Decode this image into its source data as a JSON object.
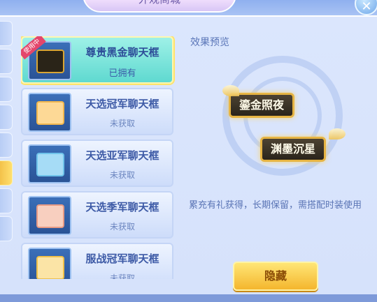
{
  "header": {
    "title": "外观商城"
  },
  "list": {
    "items": [
      {
        "name": "尊贵黑金聊天框",
        "status": "已拥有",
        "badge": "使用中",
        "frame": "black"
      },
      {
        "name": "天选冠军聊天框",
        "status": "未获取",
        "frame": "champion"
      },
      {
        "name": "天选亚军聊天框",
        "status": "未获取",
        "frame": "silver"
      },
      {
        "name": "天选季军聊天框",
        "status": "未获取",
        "frame": "bronze"
      },
      {
        "name": "服战冠军聊天框",
        "status": "未获取",
        "frame": "server"
      }
    ]
  },
  "preview": {
    "title": "效果预览",
    "bubble_1": "鎏金照夜",
    "bubble_2": "渊墨沉星",
    "description": "累充有礼获得，长期保留，需搭配时装使用"
  },
  "actions": {
    "hide_label": "隐藏"
  },
  "icons": {
    "close": "close-icon"
  },
  "colors": {
    "accent": "#f4b62e",
    "selected": "#5fd9d0",
    "badge": "#e4466b"
  }
}
